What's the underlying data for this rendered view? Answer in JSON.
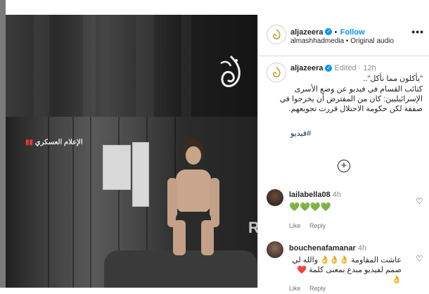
{
  "post": {
    "author": "aljazeera",
    "follow_label": "Follow",
    "sub_line": "almashhadmedia • Original audio",
    "more_icon": "•••",
    "verified_glyph": "✓"
  },
  "caption": {
    "author": "aljazeera",
    "edited_label": "Edited",
    "time": "12h",
    "quote_line": "\"يأكلون مما نأكل\"..",
    "body": "كتائب القسام في فيديو عن وضع الأسرى الإسرائيليين: كان من المفترض أن يخرجوا في صفقة لكن حكومة الاحتلال قررت تجويعهم.",
    "hashtag": "فيديو#"
  },
  "load_more_icon": "+",
  "video": {
    "logo_text": "الجزيرة",
    "overlay_text": "الإعلام العسكري",
    "overlay_mark": "R"
  },
  "comments": [
    {
      "user": "lailabella08",
      "time": "4h",
      "text": "💚💚💚💚",
      "like_label": "Like",
      "reply_label": "Reply"
    },
    {
      "user": "bouchenafamanar",
      "time": "4h",
      "text": "عاشت المقاومة 👌👌👌 والله لي صمم لفيديو مبدع بمعنى كلمة ❤️👌",
      "like_label": "Like",
      "reply_label": "Reply"
    }
  ],
  "colors": {
    "accent": "#0095f6",
    "link": "#00376b",
    "text": "#262626",
    "muted": "#8e8e8e"
  }
}
